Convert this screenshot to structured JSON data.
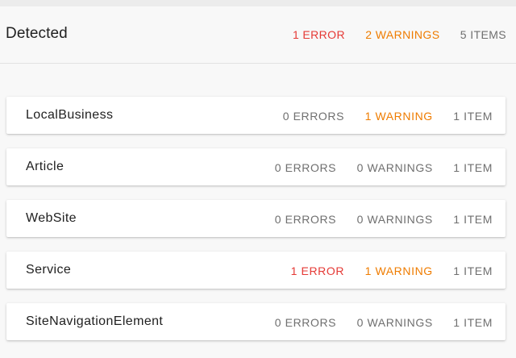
{
  "header": {
    "title": "Detected",
    "errors": "1 ERROR",
    "warnings": "2 WARNINGS",
    "items": "5 ITEMS"
  },
  "colors": {
    "error": "#e53935",
    "warning": "#ef7c00",
    "neutral": "#6f6f6f"
  },
  "cards": [
    {
      "name": "LocalBusiness",
      "errors": "0 ERRORS",
      "warnings": "1 WARNING",
      "items": "1 ITEM"
    },
    {
      "name": "Article",
      "errors": "0 ERRORS",
      "warnings": "0 WARNINGS",
      "items": "1 ITEM"
    },
    {
      "name": "WebSite",
      "errors": "0 ERRORS",
      "warnings": "0 WARNINGS",
      "items": "1 ITEM"
    },
    {
      "name": "Service",
      "errors": "1 ERROR",
      "warnings": "1 WARNING",
      "items": "1 ITEM"
    },
    {
      "name": "SiteNavigationElement",
      "errors": "0 ERRORS",
      "warnings": "0 WARNINGS",
      "items": "1 ITEM"
    }
  ]
}
